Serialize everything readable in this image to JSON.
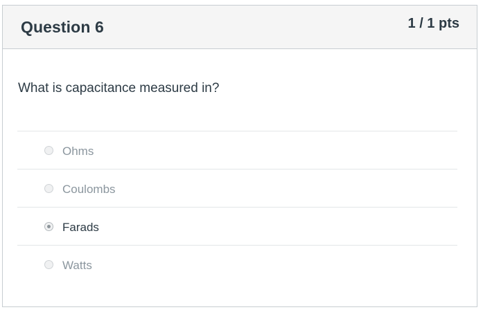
{
  "question": {
    "title": "Question 6",
    "points": "1 / 1 pts",
    "text": "What is capacitance measured in?"
  },
  "answers": [
    {
      "label": "Ohms",
      "selected": false
    },
    {
      "label": "Coulombs",
      "selected": false
    },
    {
      "label": "Farads",
      "selected": true
    },
    {
      "label": "Watts",
      "selected": false
    }
  ]
}
